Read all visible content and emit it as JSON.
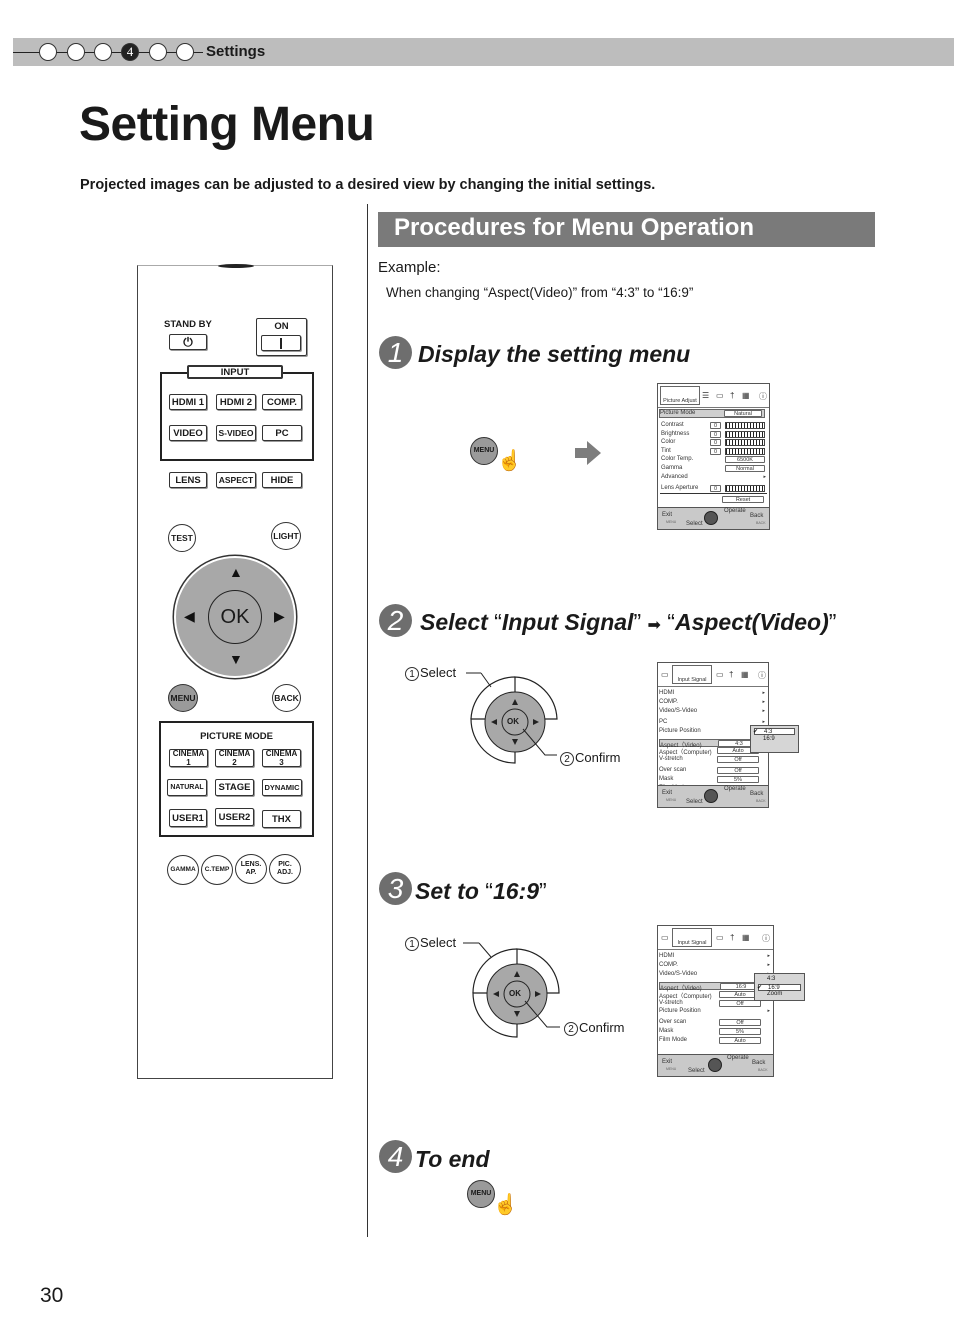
{
  "header": {
    "chapter_dots": [
      "",
      "",
      "",
      "4",
      "",
      ""
    ],
    "active_chapter": "4",
    "section": "Settings"
  },
  "page": {
    "title": "Setting Menu",
    "intro": "Projected images can be adjusted to a desired view by changing the initial settings.",
    "page_number": "30"
  },
  "procedure": {
    "heading": "Procedures for Menu Operation",
    "example_label": "Example:",
    "example_text": "When changing “Aspect(Video)” from “4:3” to “16:9”",
    "steps": [
      {
        "num": "1",
        "title": "Display the setting menu"
      },
      {
        "num": "2",
        "title_parts": [
          "Select ",
          "“",
          "Input Signal",
          "”",
          "➡",
          "“",
          "Aspect(Video)",
          "”"
        ]
      },
      {
        "num": "3",
        "title_parts": [
          "Set to ",
          "“",
          "16:9",
          "”"
        ]
      },
      {
        "num": "4",
        "title": "To end"
      }
    ],
    "nav_labels": {
      "select": "Select",
      "confirm": "Confirm",
      "select_num": "1",
      "confirm_num": "2",
      "ok": "OK"
    },
    "menu_button": "MENU"
  },
  "remote": {
    "standby_label": "STAND BY",
    "on_label": "ON",
    "input_label": "INPUT",
    "input_buttons": [
      "HDMI 1",
      "HDMI 2",
      "COMP.",
      "VIDEO",
      "S-VIDEO",
      "PC"
    ],
    "row_buttons": [
      "LENS",
      "ASPECT",
      "HIDE"
    ],
    "test": "TEST",
    "light": "LIGHT",
    "ok": "OK",
    "menu": "MENU",
    "back": "BACK",
    "picture_mode_label": "PICTURE MODE",
    "picture_mode_buttons": [
      [
        "CINEMA",
        "1"
      ],
      [
        "CINEMA",
        "2"
      ],
      [
        "CINEMA",
        "3"
      ],
      [
        "NATURAL",
        ""
      ],
      [
        "STAGE",
        ""
      ],
      [
        "DYNAMIC",
        ""
      ],
      [
        "USER1",
        ""
      ],
      [
        "USER2",
        ""
      ],
      [
        "THX",
        ""
      ]
    ],
    "bottom_buttons": [
      [
        "GAMMA",
        ""
      ],
      [
        "C.TEMP",
        ""
      ],
      [
        "LENS.",
        "AP."
      ],
      [
        "PIC.",
        "ADJ."
      ]
    ]
  },
  "osd1": {
    "tab": "Picture Adjust",
    "picture_mode_label": "Picture Mode",
    "picture_mode_value": "Natural",
    "rows": [
      {
        "label": "Contrast",
        "num": "0",
        "kind": "slider"
      },
      {
        "label": "Brightness",
        "num": "0",
        "kind": "slider"
      },
      {
        "label": "Color",
        "num": "0",
        "kind": "slider"
      },
      {
        "label": "Tint",
        "num": "0",
        "kind": "slider"
      },
      {
        "label": "Color Temp.",
        "value": "6500K"
      },
      {
        "label": "Gamma",
        "value": "Normal"
      },
      {
        "label": "Advanced",
        "kind": "sub"
      },
      {
        "label": "Lens Aperture",
        "num": "0",
        "kind": "slider"
      }
    ],
    "reset": "Reset",
    "footer": {
      "exit": "Exit",
      "exit_key": "MENU",
      "select": "Select",
      "operate": "Operate",
      "back": "Back",
      "back_key": "BACK"
    }
  },
  "osd2": {
    "tab": "Input Signal",
    "rows": [
      {
        "label": "HDMI",
        "kind": "sub"
      },
      {
        "label": "COMP.",
        "kind": "sub"
      },
      {
        "label": "Video/S-Video",
        "kind": "sub"
      },
      {
        "label": "PC",
        "kind": "sub"
      },
      {
        "label": "Picture Position",
        "kind": "sub"
      },
      {
        "label": "Aspect（Video)",
        "value": "4:3",
        "selected": true
      },
      {
        "label": "Aspect（Computer)",
        "value": "Auto"
      },
      {
        "label": "V-stretch",
        "value": "Off"
      },
      {
        "label": "Over scan",
        "value": "Off"
      },
      {
        "label": "Mask",
        "value": "5%"
      },
      {
        "label": "Film Mode",
        "value": "Auto"
      }
    ],
    "popup": [
      "4:3",
      "16:9"
    ],
    "popup_checked": "4:3",
    "footer": {
      "exit": "Exit",
      "exit_key": "MENU",
      "select": "Select",
      "operate": "Operate",
      "back": "Back",
      "back_key": "BACK"
    }
  },
  "osd3": {
    "tab": "Input Signal",
    "rows": [
      {
        "label": "HDMI",
        "kind": "sub"
      },
      {
        "label": "COMP.",
        "kind": "sub"
      },
      {
        "label": "Video/S-Video",
        "kind": "sub"
      },
      {
        "label": "Aspect（Video)",
        "value": "16:9",
        "selected": true
      },
      {
        "label": "Aspect（Computer)",
        "value": "Auto"
      },
      {
        "label": "V-stretch",
        "value": "Off"
      },
      {
        "label": "Picture Position",
        "kind": "sub"
      },
      {
        "label": "Over scan",
        "value": "Off"
      },
      {
        "label": "Mask",
        "value": "5%"
      },
      {
        "label": "Film Mode",
        "value": "Auto"
      }
    ],
    "popup": [
      "4:3",
      "16:9",
      "Zoom"
    ],
    "popup_checked": "16:9",
    "footer": {
      "exit": "Exit",
      "exit_key": "MENU",
      "select": "Select",
      "operate": "Operate",
      "back": "Back",
      "back_key": "BACK"
    }
  }
}
